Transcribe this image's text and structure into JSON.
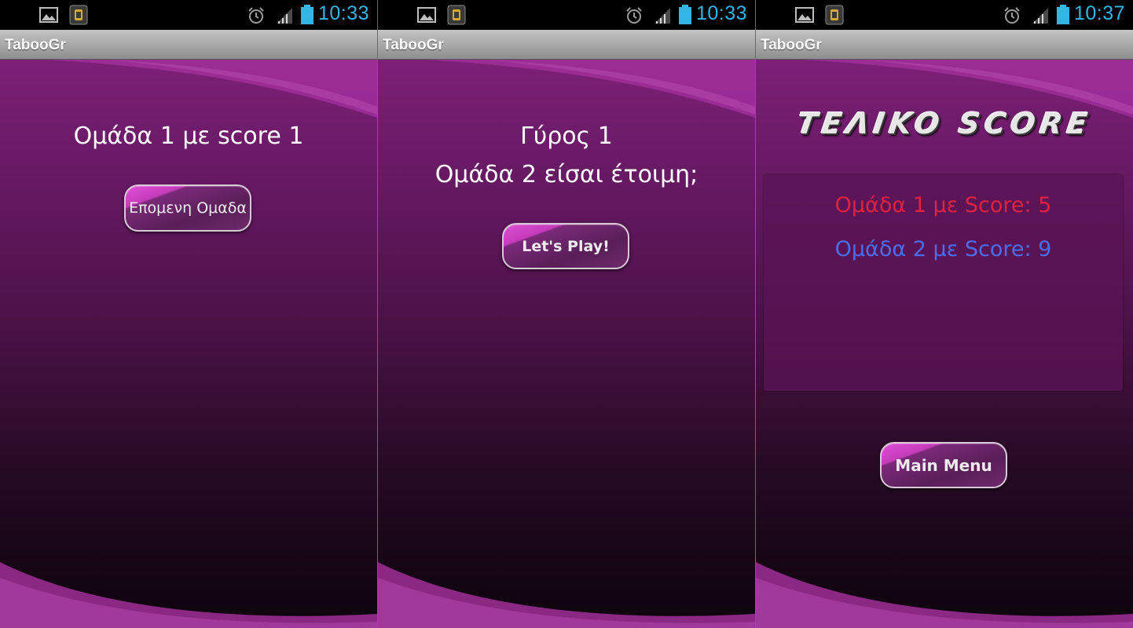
{
  "status_bars": [
    {
      "time": "10:33"
    },
    {
      "time": "10:33"
    },
    {
      "time": "10:37"
    }
  ],
  "app_title": "TabooGr",
  "screen1": {
    "team_score_text": "Ομάδα  1 με score  1",
    "next_team_button": "Επομενη Ομαδα"
  },
  "screen2": {
    "round_text": "Γύρος 1",
    "ready_text": "Ομάδα  2 είσαι έτοιμη;",
    "play_button": "Let's Play!"
  },
  "screen3": {
    "final_title": "TEΛIKO SCORE",
    "team1_score": "Ομάδα 1 με Score: 5",
    "team2_score": "Ομάδα 2 με Score: 9",
    "main_menu_button": "Main Menu"
  },
  "colors": {
    "status_time": "#33b5e5",
    "team1": "#e0223f",
    "team2": "#4a6ef0",
    "accent": "#c43cba"
  }
}
